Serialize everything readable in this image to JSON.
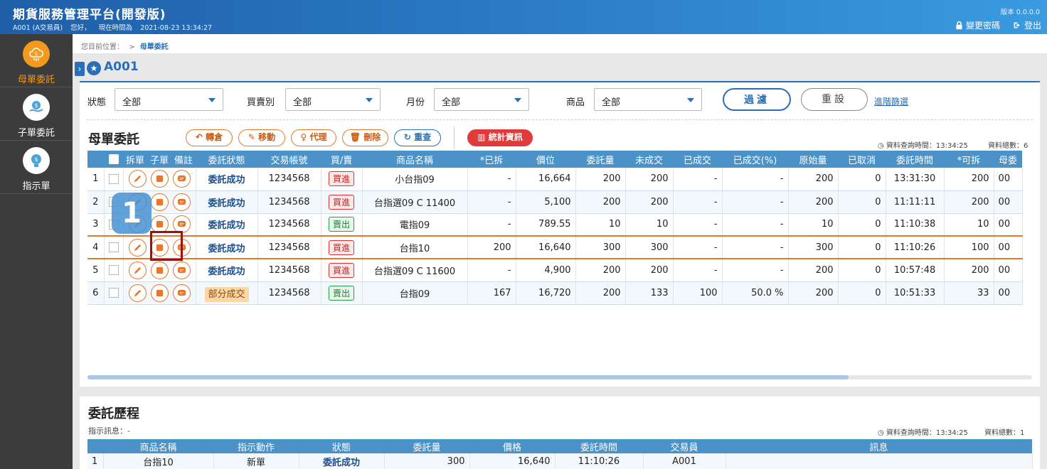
{
  "header": {
    "title": "期貨服務管理平台(開發版)",
    "user": "A001 (A交易員)",
    "greeting": "您好，",
    "time_label": "現在時間為",
    "time": "2021-08-23 13:34:27",
    "version": "版本 0.0.0.0",
    "change_password": "變更密碼",
    "logout": "登出"
  },
  "sidebar": {
    "items": [
      {
        "label": "母單委託",
        "active": true
      },
      {
        "label": "子單委託"
      },
      {
        "label": "指示單"
      }
    ]
  },
  "breadcrumb": {
    "prefix": "您目前位置：",
    "sep": ">",
    "current": "母單委託"
  },
  "page": {
    "title": "A001"
  },
  "filters": {
    "status_label": "狀態",
    "status_value": "全部",
    "side_label": "買賣別",
    "side_value": "全部",
    "month_label": "月份",
    "month_value": "全部",
    "product_label": "商品",
    "product_value": "全部",
    "filter_btn": "過濾",
    "reset_btn": "重設",
    "advanced_link": "進階篩選"
  },
  "toolbar": {
    "section_title": "母單委託",
    "transfer": "轉倉",
    "move": "移動",
    "proxy": "代理",
    "delete": "刪除",
    "requery": "重查",
    "stats": "統計資訊",
    "query_time": "資料查詢時間：13:34:25",
    "total": "資料總數：6"
  },
  "table": {
    "headers": [
      "拆單",
      "子單",
      "備註",
      "委託狀態",
      "交易帳號",
      "買/賣",
      "商品名稱",
      "*已拆",
      "價位",
      "委託量",
      "未成交",
      "已成交",
      "已成交(%)",
      "原始量",
      "已取消",
      "委託時間",
      "*可拆",
      "母委"
    ],
    "rows": [
      {
        "no": "1",
        "status": "委託成功",
        "account": "1234568",
        "side": "買進",
        "product": "小台指09",
        "split": "-",
        "price": "16,664",
        "qty": "200",
        "unfilled": "200",
        "filled": "-",
        "filled_pct": "-",
        "orig": "200",
        "cancel": "0",
        "time": "13:31:30",
        "can_split": "200",
        "parent": "00"
      },
      {
        "no": "2",
        "status": "委託成功",
        "account": "1234568",
        "side": "買進",
        "product": "台指選09 C 11400",
        "split": "-",
        "price": "5,100",
        "qty": "200",
        "unfilled": "200",
        "filled": "-",
        "filled_pct": "-",
        "orig": "200",
        "cancel": "0",
        "time": "11:11:11",
        "can_split": "200",
        "parent": "00"
      },
      {
        "no": "3",
        "status": "委託成功",
        "account": "1234568",
        "side": "賣出",
        "product": "電指09",
        "split": "-",
        "price": "789.55",
        "qty": "10",
        "unfilled": "10",
        "filled": "-",
        "filled_pct": "-",
        "orig": "10",
        "cancel": "0",
        "time": "11:10:38",
        "can_split": "10",
        "parent": "00"
      },
      {
        "no": "4",
        "status": "委託成功",
        "account": "1234568",
        "side": "買進",
        "product": "台指10",
        "split": "200",
        "price": "16,640",
        "qty": "300",
        "unfilled": "300",
        "filled": "-",
        "filled_pct": "-",
        "orig": "300",
        "cancel": "0",
        "time": "11:10:26",
        "can_split": "100",
        "parent": "00"
      },
      {
        "no": "5",
        "status": "委託成功",
        "account": "1234568",
        "side": "買進",
        "product": "台指選09 C 11600",
        "split": "-",
        "price": "4,900",
        "qty": "200",
        "unfilled": "200",
        "filled": "-",
        "filled_pct": "-",
        "orig": "200",
        "cancel": "0",
        "time": "10:57:48",
        "can_split": "200",
        "parent": "00"
      },
      {
        "no": "6",
        "status": "部分成交",
        "account": "1234568",
        "side": "賣出",
        "product": "台指09",
        "split": "167",
        "price": "16,720",
        "qty": "200",
        "unfilled": "133",
        "filled": "100",
        "filled_pct": "50.0 %",
        "orig": "200",
        "cancel": "0",
        "time": "10:51:33",
        "can_split": "33",
        "parent": "00"
      }
    ]
  },
  "step_badge": "1",
  "history": {
    "title": "委託歷程",
    "info": "指示訊息：-",
    "query_time": "資料查詢時間：13:34:25",
    "total": "資料總數：1",
    "headers": [
      "商品名稱",
      "指示動作",
      "狀態",
      "委託量",
      "價格",
      "委託時間",
      "交易員",
      "訊息"
    ],
    "rows": [
      {
        "no": "1",
        "product": "台指10",
        "action": "新單",
        "status": "委託成功",
        "qty": "300",
        "price": "16,640",
        "time": "11:10:26",
        "trader": "A001",
        "message": ""
      }
    ]
  },
  "colors": {
    "primary": "#2a6fb5",
    "accent": "#e8772e",
    "header_bg": "#4a92c8",
    "sidebar_bg": "#3c3c3c"
  }
}
